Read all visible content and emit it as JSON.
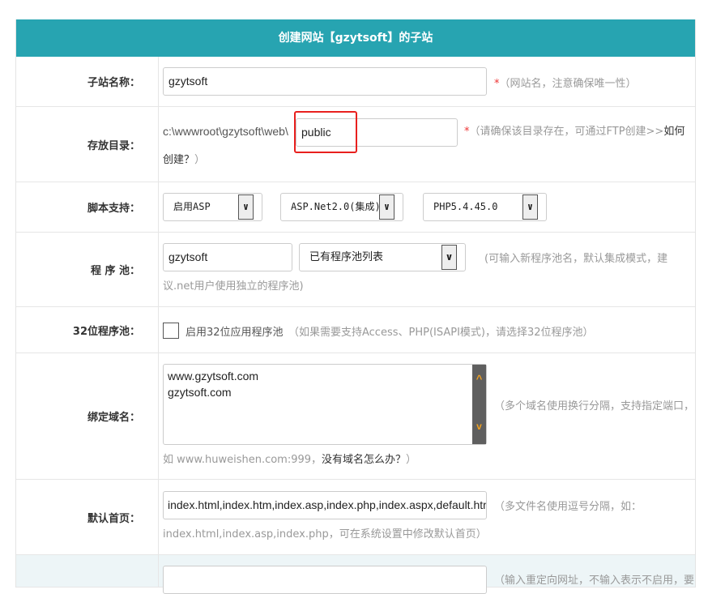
{
  "title": "创建网站【gzytsoft】的子站",
  "rows": {
    "name": {
      "label": "子站名称：",
      "value": "gzytsoft",
      "required": "*",
      "hint": "（网站名，注意确保唯一性）"
    },
    "dir": {
      "label": "存放目录：",
      "prefix": "c:\\wwwroot\\gzytsoft\\web\\",
      "value": "public",
      "required": "*",
      "hint": "（请确保该目录存在，可通过FTP创建>>",
      "link": "如何创建？",
      "hint_end": "）"
    },
    "script": {
      "label": "脚本支持：",
      "asp": "启用ASP",
      "net": "ASP.Net2.0(集成)",
      "php": "PHP5.4.45.0"
    },
    "pool": {
      "label": "程 序 池：",
      "value": "gzytsoft",
      "select": "已有程序池列表",
      "hint1": "(可输入新程序池名，默认集成模式，建",
      "hint2": "议.net用户使用独立的程序池)"
    },
    "pool32": {
      "label": "32位程序池：",
      "checkbox_label": "启用32位应用程序池",
      "checked": false,
      "hint": "（如果需要支持Access、PHP(ISAPI模式)，请选择32位程序池）"
    },
    "domain": {
      "label": "绑定域名：",
      "values": [
        "www.gzytsoft.com",
        "gzytsoft.com"
      ],
      "hint": "（多个域名使用换行分隔，支持指定端口，",
      "hint2": "如 www.huweishen.com:999，",
      "link": "没有域名怎么办？",
      "hint2_end": "）"
    },
    "index": {
      "label": "默认首页：",
      "value": "index.html,index.htm,index.asp,index.php,index.aspx,default.htm",
      "hint": "（多文件名使用逗号分隔，如：",
      "hint2": "index.html,index.asp,index.php，可在系统设置中修改默认首页）"
    },
    "redirect": {
      "value": "",
      "hint": "（输入重定向网址，不输入表示不启用，要"
    }
  },
  "colors": {
    "header": "#27a4b1",
    "highlight": "#e8201e",
    "required": "#e33333",
    "scroll_arrow": "#f0a020"
  }
}
